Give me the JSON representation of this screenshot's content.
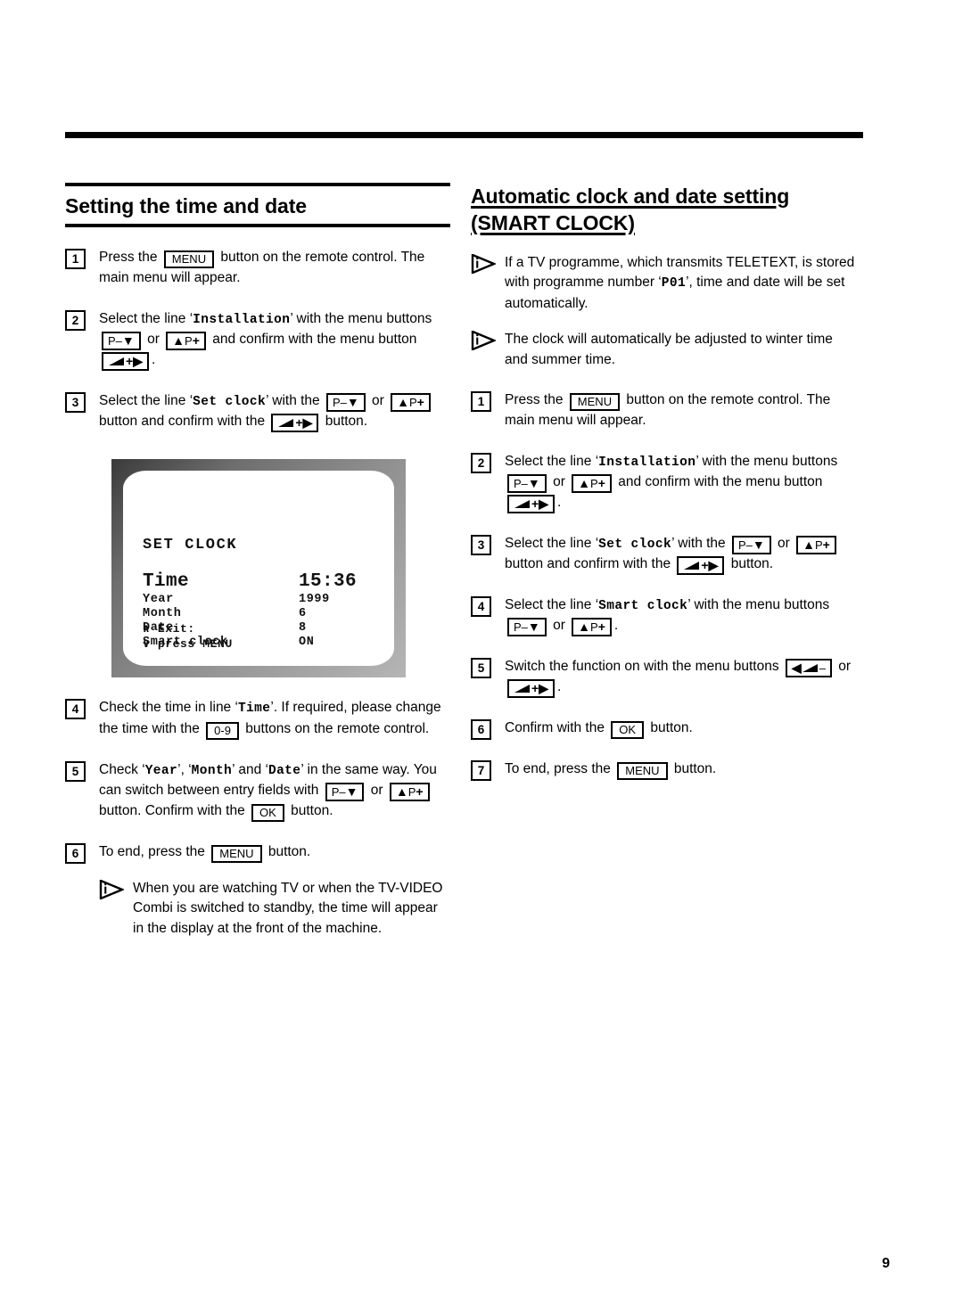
{
  "page": {
    "number": "9"
  },
  "left_column": {
    "heading": "Setting the time and date",
    "steps": [
      {
        "num": "1",
        "parts": [
          {
            "t": "text",
            "v": "Press the "
          },
          {
            "t": "key",
            "v": "MENU"
          },
          {
            "t": "text",
            "v": " button on the remote control. The main menu will appear."
          }
        ]
      },
      {
        "num": "2",
        "parts": [
          {
            "t": "text",
            "v": "Select the line "
          },
          {
            "t": "quote_mono",
            "v": "Installation"
          },
          {
            "t": "text",
            "v": " with the menu buttons "
          },
          {
            "t": "key",
            "v": "P–▼"
          },
          {
            "t": "text",
            "v": " or "
          },
          {
            "t": "key",
            "v": "▲P+"
          },
          {
            "t": "text",
            "v": " and confirm with the menu button "
          },
          {
            "t": "key",
            "v": "⮡+▶"
          },
          {
            "t": "text",
            "v": "."
          }
        ]
      },
      {
        "num": "3",
        "parts": [
          {
            "t": "text",
            "v": "Select the line "
          },
          {
            "t": "quote_mono",
            "v": "Set clock"
          },
          {
            "t": "text",
            "v": " with the "
          },
          {
            "t": "key",
            "v": "P–▼"
          },
          {
            "t": "text",
            "v": " or "
          },
          {
            "t": "key",
            "v": "▲P+"
          },
          {
            "t": "text",
            "v": " button and confirm with the "
          },
          {
            "t": "key",
            "v": "⮡+▶"
          },
          {
            "t": "text",
            "v": " button."
          }
        ]
      },
      {
        "num": "4",
        "parts": [
          {
            "t": "text",
            "v": "Check the time in line "
          },
          {
            "t": "quote_mono",
            "v": "Time"
          },
          {
            "t": "text",
            "v": ". If required, please change the time with the "
          },
          {
            "t": "key",
            "v": "0-9"
          },
          {
            "t": "text",
            "v": " buttons on the remote control."
          }
        ]
      },
      {
        "num": "5",
        "parts": [
          {
            "t": "text",
            "v": "Check "
          },
          {
            "t": "quote_mono",
            "v": "Year"
          },
          {
            "t": "text",
            "v": ", "
          },
          {
            "t": "quote_mono",
            "v": "Month"
          },
          {
            "t": "text",
            "v": " and "
          },
          {
            "t": "quote_mono",
            "v": "Date"
          },
          {
            "t": "text",
            "v": " in the same way. You can switch between entry fields with "
          },
          {
            "t": "key",
            "v": "P–▼"
          },
          {
            "t": "text",
            "v": " or "
          },
          {
            "t": "key",
            "v": "▲P+"
          },
          {
            "t": "text",
            "v": " button. Confirm with the "
          },
          {
            "t": "key",
            "v": "OK"
          },
          {
            "t": "text",
            "v": " button."
          }
        ]
      },
      {
        "num": "6",
        "parts": [
          {
            "t": "text",
            "v": "To end, press the "
          },
          {
            "t": "key",
            "v": "MENU"
          },
          {
            "t": "text",
            "v": " button."
          }
        ]
      }
    ],
    "note": "When you are watching TV or when the TV-VIDEO Combi is switched to standby, the time will appear in the display at the front of the machine."
  },
  "tv_screen": {
    "title": "SET CLOCK",
    "rows": [
      {
        "label": "Time",
        "value": "15:36"
      },
      {
        "label": "Year",
        "value": "1999"
      },
      {
        "label": "Month",
        "value": "6"
      },
      {
        "label": "Date",
        "value": "8"
      },
      {
        "label": "Smart clock",
        "value": "ON"
      }
    ],
    "footer_line1": "∧ Exit:",
    "footer_line2": "∨ press MENU"
  },
  "right_column": {
    "heading_line1": "Automatic clock and date setting",
    "heading_line2": "(SMART CLOCK)",
    "notes": [
      {
        "parts": [
          {
            "t": "text",
            "v": "If a TV programme, which transmits TELETEXT, is stored with programme number "
          },
          {
            "t": "quote_mono",
            "v": "P01"
          },
          {
            "t": "text",
            "v": ", time and date will be set automatically."
          }
        ]
      },
      {
        "parts": [
          {
            "t": "text",
            "v": "The clock will automatically be adjusted to winter time and summer time."
          }
        ]
      }
    ],
    "steps": [
      {
        "num": "1",
        "parts": [
          {
            "t": "text",
            "v": "Press the "
          },
          {
            "t": "key",
            "v": "MENU"
          },
          {
            "t": "text",
            "v": " button on the remote control. The main menu will appear."
          }
        ]
      },
      {
        "num": "2",
        "parts": [
          {
            "t": "text",
            "v": "Select the line "
          },
          {
            "t": "quote_mono",
            "v": "Installation"
          },
          {
            "t": "text",
            "v": " with the menu buttons "
          },
          {
            "t": "key",
            "v": "P–▼"
          },
          {
            "t": "text",
            "v": " or "
          },
          {
            "t": "key",
            "v": "▲P+"
          },
          {
            "t": "text",
            "v": " and confirm with the menu button "
          },
          {
            "t": "key",
            "v": "⮡+▶"
          },
          {
            "t": "text",
            "v": "."
          }
        ]
      },
      {
        "num": "3",
        "parts": [
          {
            "t": "text",
            "v": "Select the line "
          },
          {
            "t": "quote_mono",
            "v": "Set clock"
          },
          {
            "t": "text",
            "v": " with the "
          },
          {
            "t": "key",
            "v": "P–▼"
          },
          {
            "t": "text",
            "v": " or "
          },
          {
            "t": "key",
            "v": "▲P+"
          },
          {
            "t": "text",
            "v": " button and confirm with the "
          },
          {
            "t": "key",
            "v": "⮡+▶"
          },
          {
            "t": "text",
            "v": " button."
          }
        ]
      },
      {
        "num": "4",
        "parts": [
          {
            "t": "text",
            "v": "Select the line "
          },
          {
            "t": "quote_mono",
            "v": "Smart clock"
          },
          {
            "t": "text",
            "v": " with the menu buttons "
          },
          {
            "t": "key",
            "v": "P–▼"
          },
          {
            "t": "text",
            "v": " or "
          },
          {
            "t": "key",
            "v": "▲P+"
          },
          {
            "t": "text",
            "v": "."
          }
        ]
      },
      {
        "num": "5",
        "parts": [
          {
            "t": "text",
            "v": "Switch the function on with the menu buttons "
          },
          {
            "t": "key",
            "v": "◀⮡–"
          },
          {
            "t": "text",
            "v": " or "
          },
          {
            "t": "key",
            "v": "⮡+▶"
          },
          {
            "t": "text",
            "v": "."
          }
        ]
      },
      {
        "num": "6",
        "parts": [
          {
            "t": "text",
            "v": "Confirm with the "
          },
          {
            "t": "key",
            "v": "OK"
          },
          {
            "t": "text",
            "v": " button."
          }
        ]
      },
      {
        "num": "7",
        "parts": [
          {
            "t": "text",
            "v": "To end, press the "
          },
          {
            "t": "key",
            "v": "MENU"
          },
          {
            "t": "text",
            "v": " button."
          }
        ]
      }
    ]
  }
}
